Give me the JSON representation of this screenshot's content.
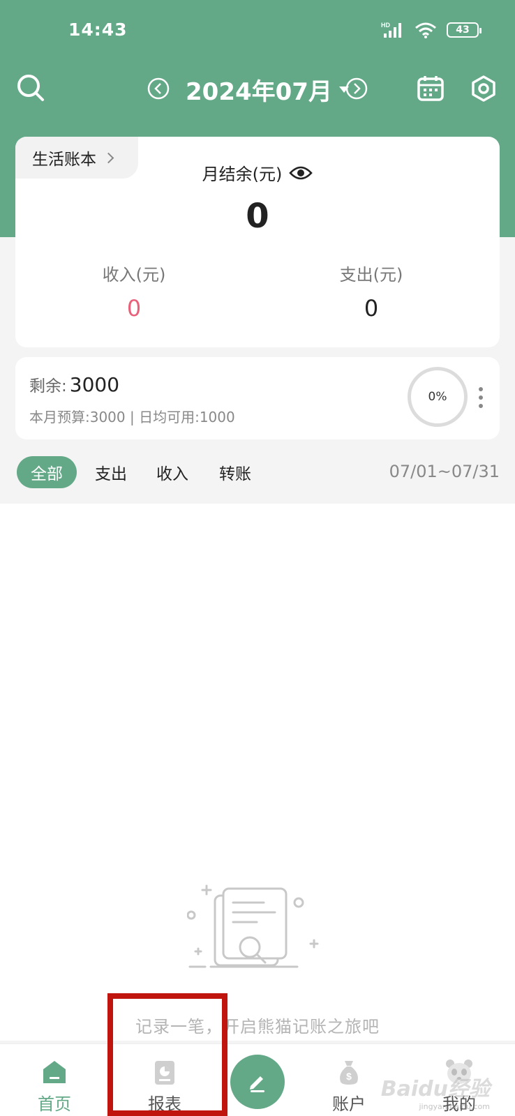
{
  "status_bar": {
    "time": "14:43",
    "network": "HD",
    "battery": "43"
  },
  "header": {
    "month": "2024年07月",
    "icons": {
      "search": "search-icon",
      "prev": "chevron-left-icon",
      "next": "chevron-right-icon",
      "calendar": "calendar-icon",
      "settings": "settings-icon"
    }
  },
  "summary": {
    "book_name": "生活账本",
    "balance_label": "月结余(元)",
    "balance_value": "0",
    "income_label": "收入(元)",
    "income_value": "0",
    "expense_label": "支出(元)",
    "expense_value": "0",
    "colors": {
      "income": "#e8607a",
      "brand": "#63a987"
    }
  },
  "budget": {
    "remain_label": "剩余:",
    "remain_value": "3000",
    "subtitle": "本月预算:3000 | 日均可用:1000",
    "progress_text": "0%",
    "progress": 0
  },
  "filters": {
    "tabs": [
      "全部",
      "支出",
      "收入",
      "转账"
    ],
    "active": 0,
    "date_range": "07/01~07/31"
  },
  "empty_state": {
    "text": "记录一笔，开启熊猫记账之旅吧"
  },
  "tabbar": {
    "items": [
      {
        "label": "首页",
        "icon": "home-icon"
      },
      {
        "label": "报表",
        "icon": "report-icon"
      },
      {
        "label": "账户",
        "icon": "money-bag-icon"
      },
      {
        "label": "我的",
        "icon": "panda-icon"
      }
    ],
    "fab_icon": "pencil-icon"
  },
  "watermark": {
    "text": "Baidu经验",
    "sub": "jingyan.baidu.com"
  }
}
